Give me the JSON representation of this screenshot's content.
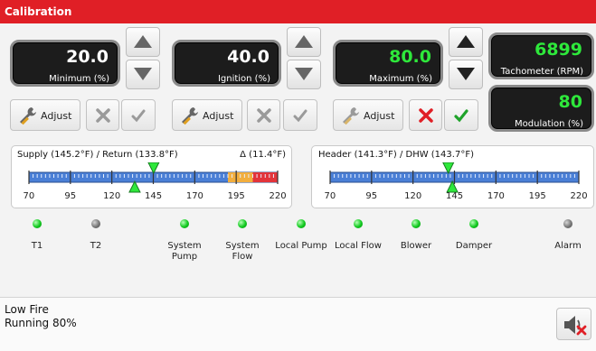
{
  "window": {
    "title": "Calibration"
  },
  "readouts": {
    "minimum": {
      "value": "20.0",
      "label": "Minimum (%)",
      "color": "#ffffff"
    },
    "ignition": {
      "value": "40.0",
      "label": "Ignition (%)",
      "color": "#ffffff"
    },
    "maximum": {
      "value": "80.0",
      "label": "Maximum (%)",
      "color": "#2ee83b"
    },
    "tachometer": {
      "value": "6899",
      "label": "Tachometer (RPM)",
      "color": "#2ee83b"
    },
    "modulation": {
      "value": "80",
      "label": "Modulation (%)",
      "color": "#2ee83b"
    }
  },
  "buttons": {
    "adjust_label": "Adjust"
  },
  "colors": {
    "title_bar": "#e01f26",
    "cancel_active": "#e01f26",
    "confirm_active": "#1fa32a",
    "inactive_icon": "#9a9a9a",
    "scale_blue": "#4a7fd6",
    "scale_orange": "#f2ae3e",
    "scale_red": "#e2343a",
    "marker_green": "#2ee83b"
  },
  "gauges": {
    "supply_return": {
      "title": "Supply (145.2°F) / Return (133.8°F)",
      "delta": "Δ (11.4°F)",
      "ticks": [
        "70",
        "95",
        "120",
        "145",
        "170",
        "195",
        "220"
      ],
      "range": [
        70,
        220
      ],
      "supply": 145.2,
      "return": 133.8,
      "warning_from": 190,
      "alarm_from": 205
    },
    "header_dhw": {
      "title": "Header (141.3°F) / DHW (143.7°F)",
      "ticks": [
        "70",
        "95",
        "120",
        "145",
        "170",
        "195",
        "220"
      ],
      "range": [
        70,
        220
      ],
      "header": 141.3,
      "dhw": 143.7
    }
  },
  "indicators": [
    {
      "label": "T1",
      "state": "on"
    },
    {
      "label": "T2",
      "state": "off"
    },
    {
      "label": "System Pump",
      "state": "on"
    },
    {
      "label": "System Flow",
      "state": "on"
    },
    {
      "label": "Local Pump",
      "state": "on"
    },
    {
      "label": "Local Flow",
      "state": "on"
    },
    {
      "label": "Blower",
      "state": "on"
    },
    {
      "label": "Damper",
      "state": "on"
    },
    {
      "label": "Alarm",
      "state": "off"
    }
  ],
  "status": {
    "line1": "Low Fire",
    "line2": "Running 80%"
  },
  "icons": {
    "adjust": "wrench-icon",
    "cancel": "x-icon",
    "confirm": "check-icon",
    "increase": "arrow-up-icon",
    "decrease": "arrow-down-icon",
    "mute": "speaker-muted-icon"
  }
}
